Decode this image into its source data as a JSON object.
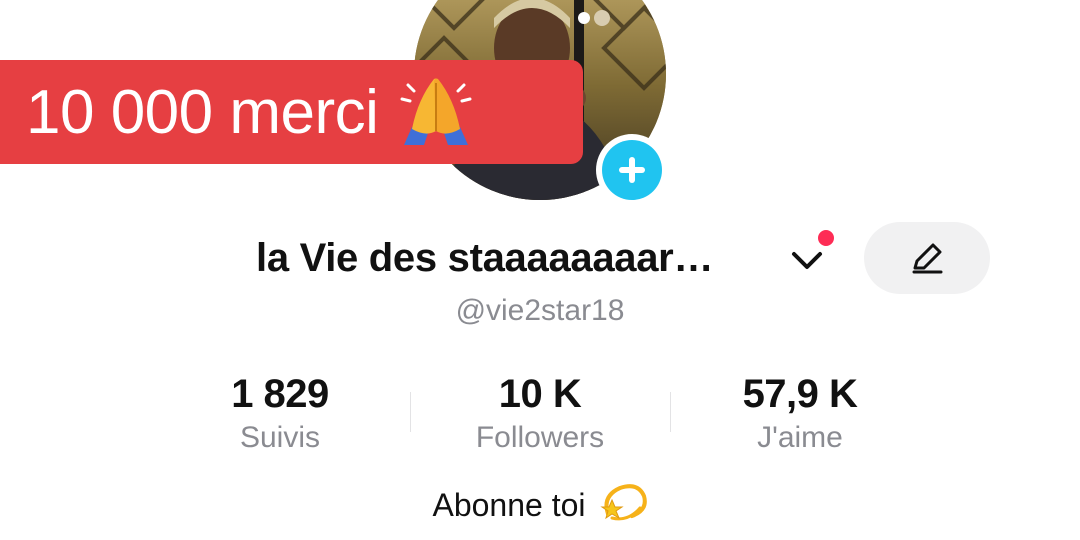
{
  "banner": {
    "text": "10 000 merci",
    "icon": "folded-hands-icon",
    "color": "#e63f42"
  },
  "profile": {
    "display_name": "la Vie des staaaaaaaar…",
    "username": "@vie2star18",
    "avatar_icon": "profile-photo",
    "add_icon": "plus-icon",
    "accent_color": "#20c4f0",
    "notification_color": "#fe2c55"
  },
  "stats": [
    {
      "value": "1 829",
      "label": "Suivis"
    },
    {
      "value": "10 K",
      "label": "Followers"
    },
    {
      "value": "57,9 K",
      "label": "J'aime"
    }
  ],
  "bio": {
    "text": "Abonne toi",
    "icon": "dizzy-star-icon"
  },
  "actions": {
    "edit_icon": "pencil-icon",
    "switch_icon": "chevron-down-icon"
  }
}
